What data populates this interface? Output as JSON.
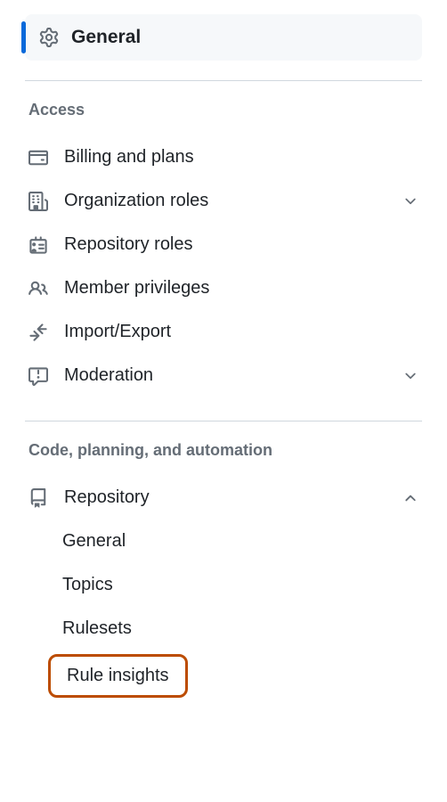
{
  "general": {
    "label": "General"
  },
  "sections": {
    "access": {
      "header": "Access",
      "items": {
        "billing": "Billing and plans",
        "org_roles": "Organization roles",
        "repo_roles": "Repository roles",
        "member_priv": "Member privileges",
        "import_export": "Import/Export",
        "moderation": "Moderation"
      }
    },
    "code": {
      "header": "Code, planning, and automation",
      "repository": {
        "label": "Repository",
        "subitems": {
          "general": "General",
          "topics": "Topics",
          "rulesets": "Rulesets",
          "rule_insights": "Rule insights"
        }
      }
    }
  }
}
